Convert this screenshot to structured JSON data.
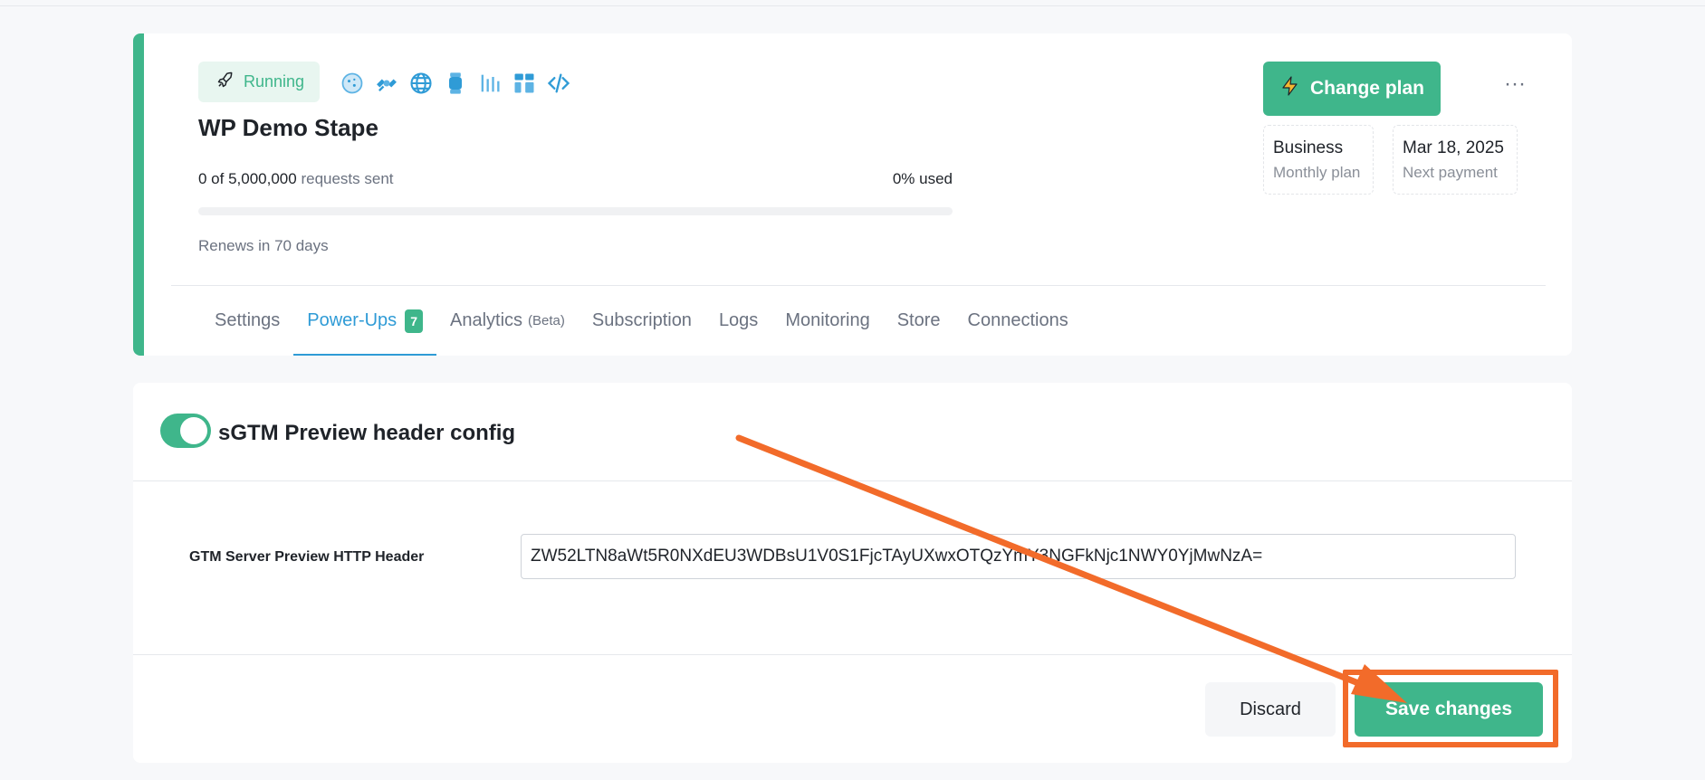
{
  "colors": {
    "accent_green": "#3fb68b",
    "link_blue": "#2f9bd6",
    "annotation_orange": "#f26b2a"
  },
  "container": {
    "status": {
      "label": "Running",
      "icon": "rocket-icon"
    },
    "powerup_icons": [
      "cookie-icon",
      "satellite-icon",
      "globe-icon",
      "watch-icon",
      "bars-icon",
      "blocks-icon",
      "code-icon"
    ],
    "name": "WP Demo Stape",
    "requests": {
      "count": "0 of 5,000,000",
      "suffix": "requests sent",
      "usage": "0% used",
      "progress_fraction": 0
    },
    "renews": "Renews in 70 days",
    "change_plan_label": "Change plan",
    "more_label": "···",
    "plan": {
      "value": "Business",
      "label": "Monthly plan"
    },
    "payment": {
      "value": "Mar 18, 2025",
      "label": "Next payment"
    }
  },
  "tabs": [
    {
      "label": "Settings"
    },
    {
      "label": "Power-Ups",
      "badge": "7"
    },
    {
      "label": "Analytics",
      "tag": "(Beta)"
    },
    {
      "label": "Subscription"
    },
    {
      "label": "Logs"
    },
    {
      "label": "Monitoring"
    },
    {
      "label": "Store"
    },
    {
      "label": "Connections"
    }
  ],
  "config": {
    "title": "sGTM Preview header config",
    "enabled": true,
    "field_label": "GTM Server Preview HTTP Header",
    "field_value": "ZW52LTN8aWt5R0NXdEU3WDBsU1V0S1FjcTAyUXwxOTQzYmY3NGFkNjc1NWY0YjMwNzA=",
    "discard_label": "Discard",
    "save_label": "Save changes"
  }
}
